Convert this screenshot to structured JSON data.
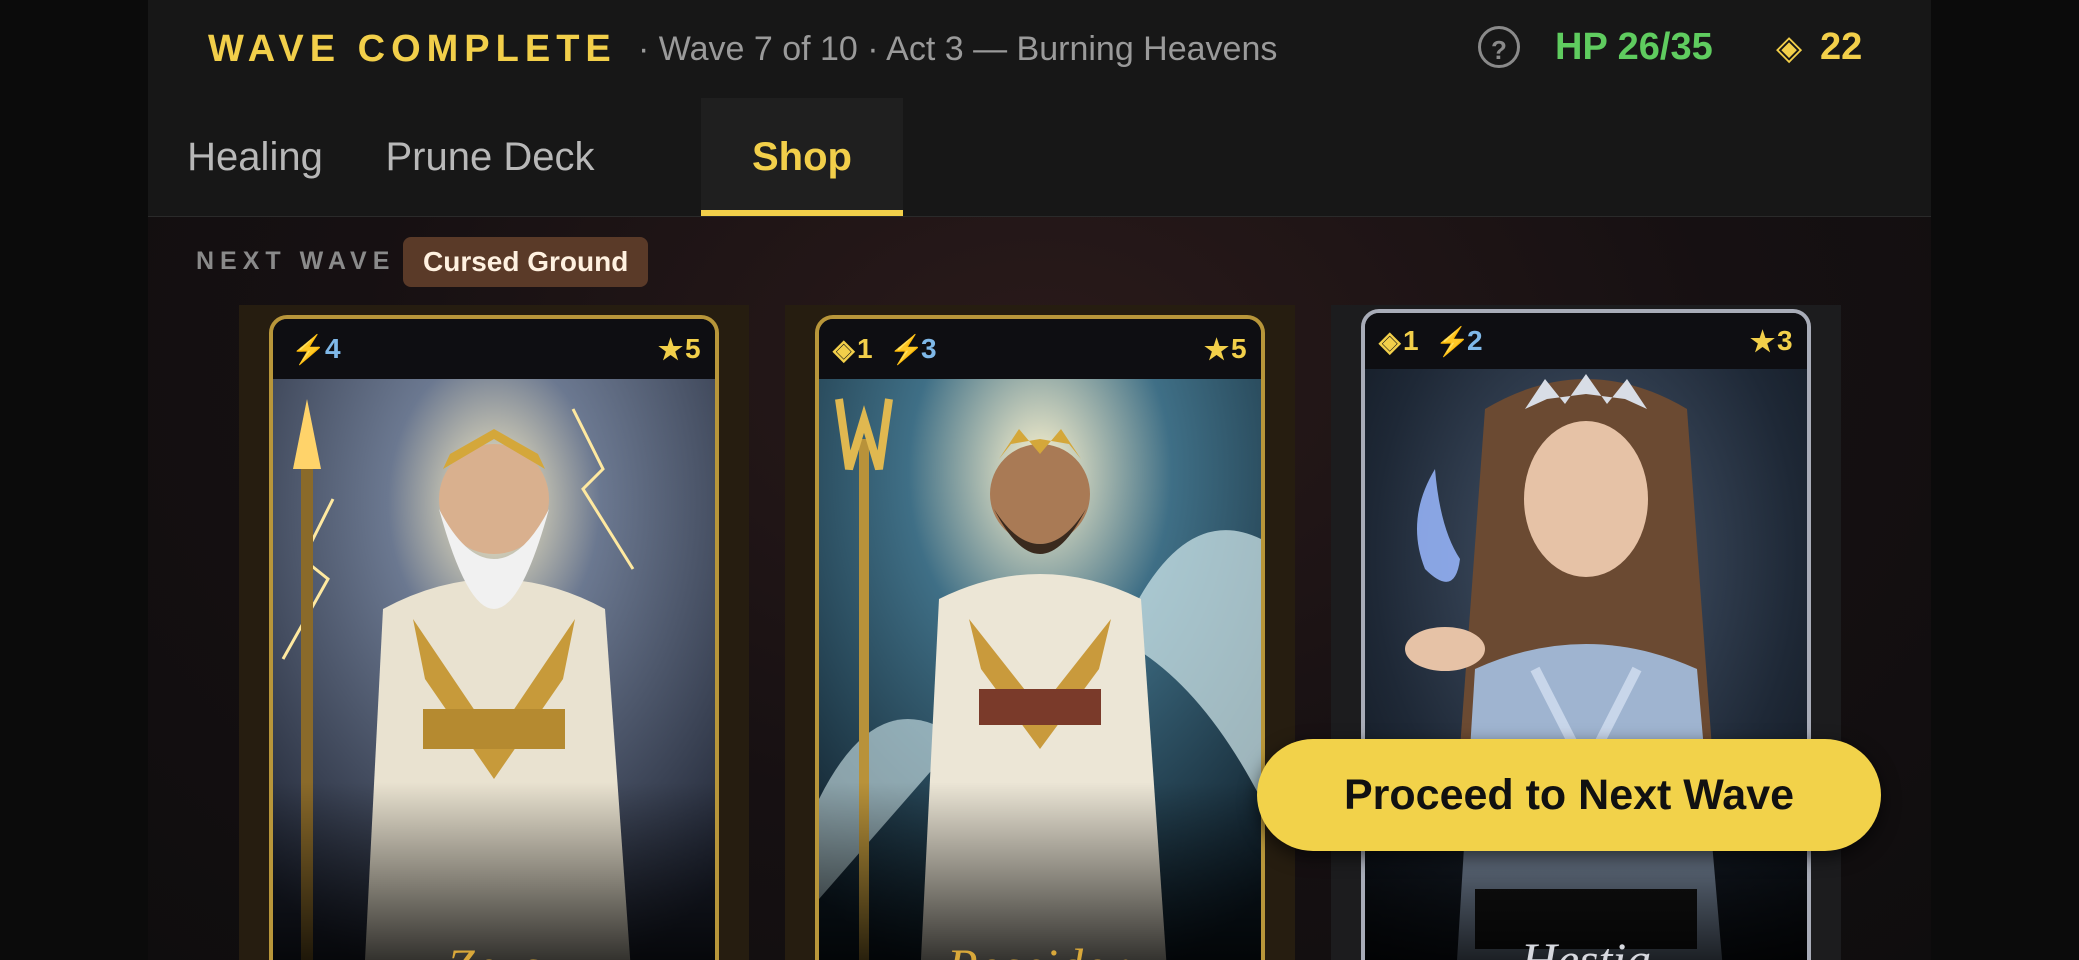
{
  "header": {
    "title": "WAVE COMPLETE",
    "subtitle": "· Wave 7 of 10 · Act 3 — Burning Heavens",
    "help_label": "?",
    "hp": "HP 26/35",
    "gold_icon": "◈",
    "gold": "22"
  },
  "tabs": [
    {
      "label": "Healing",
      "active": false
    },
    {
      "label": "Prune Deck",
      "active": false
    },
    {
      "label": "Shop",
      "active": true
    }
  ],
  "next_wave": {
    "label": "NEXT WAVE",
    "modifier": "Cursed Ground"
  },
  "cards": [
    {
      "name": "Zeus",
      "cost": "",
      "energy": "4",
      "stars": "5",
      "rarity": "gold",
      "art_icon": "zeus-portrait"
    },
    {
      "name": "Poseidon",
      "cost": "1",
      "energy": "3",
      "stars": "5",
      "rarity": "gold",
      "art_icon": "poseidon-portrait"
    },
    {
      "name": "Hestia",
      "cost": "1",
      "energy": "2",
      "stars": "3",
      "rarity": "silver",
      "art_icon": "hestia-portrait"
    }
  ],
  "icons": {
    "cost": "◈",
    "energy": "⚡",
    "star": "★"
  },
  "proceed_button": "Proceed to Next Wave",
  "colors": {
    "accent": "#f2cf4a",
    "hp": "#5fcc5f",
    "energy": "#7fb8e8",
    "badge": "#5a3a28"
  }
}
